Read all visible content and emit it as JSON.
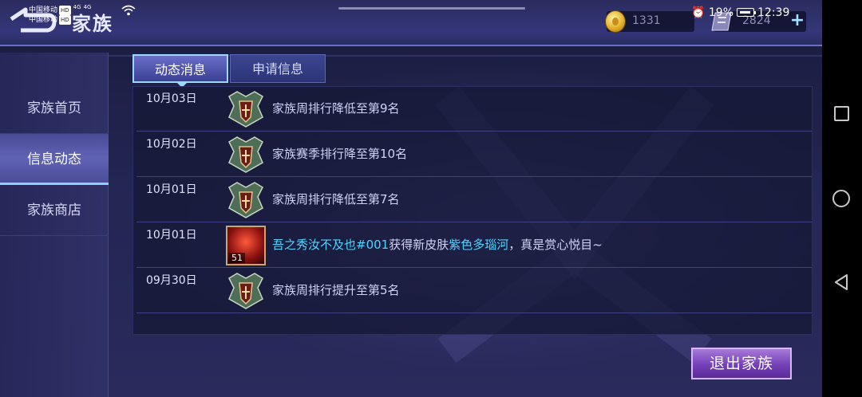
{
  "status_bar": {
    "carrier1": "中国移动",
    "carrier2": "中国移动",
    "hd": "HD",
    "net": "4G",
    "battery": "19%",
    "time": "12:39"
  },
  "header": {
    "title": "家族",
    "coins": "1331",
    "gems": "2824",
    "plus": "+"
  },
  "sidebar": {
    "items": [
      {
        "label": "家族首页"
      },
      {
        "label": "信息动态"
      },
      {
        "label": "家族商店"
      }
    ],
    "active_index": 1
  },
  "tabs": [
    {
      "label": "动态消息"
    },
    {
      "label": "申请信息"
    }
  ],
  "feed": [
    {
      "date": "10月03日",
      "text": "家族周排行降低至第9名"
    },
    {
      "date": "10月02日",
      "text": "家族赛季排行降至第10名"
    },
    {
      "date": "10月01日",
      "text": "家族周排行降低至第7名"
    },
    {
      "date": "10月01日",
      "player": "吾之秀汝不及也#001",
      "mid": "获得新皮肤",
      "skin": "紫色多瑙河",
      "tail": "，真是赏心悦目~",
      "avatar_level": "51"
    },
    {
      "date": "09月30日",
      "text": "家族周排行提升至第5名"
    }
  ],
  "actions": {
    "quit_label": "退出家族"
  },
  "colors": {
    "highlight": "#4fd4ff",
    "accent": "#9ad8ff"
  }
}
